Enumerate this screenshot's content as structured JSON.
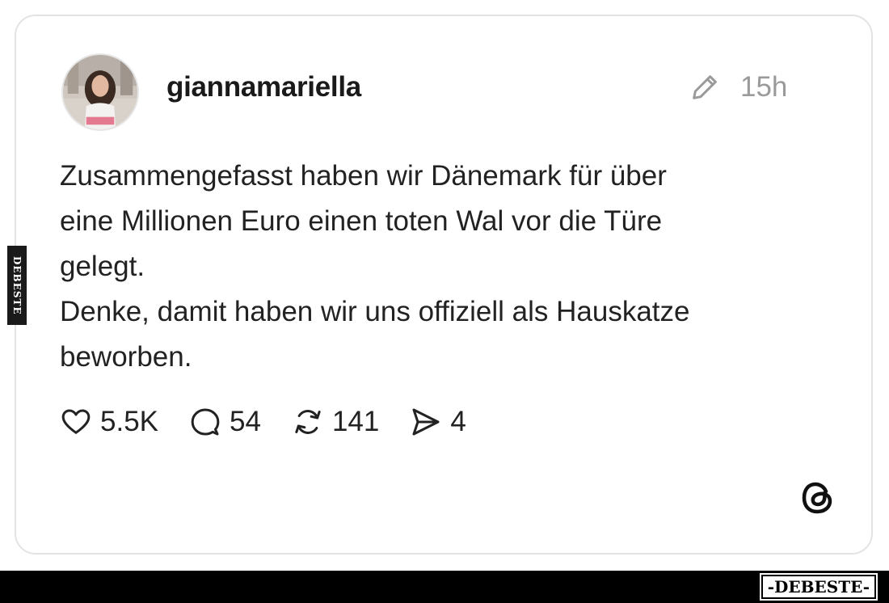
{
  "post": {
    "username": "giannamariella",
    "time": "15h",
    "text": "Zusammengefasst haben wir Dänemark für über\neine Millionen Euro einen toten Wal vor die Türe\ngelegt.\nDenke, damit haben wir uns offiziell als Hauskatze\nbeworben.",
    "likes": "5.5K",
    "replies": "54",
    "reposts": "141",
    "shares": "4"
  },
  "icons": {
    "edit": "pencil-icon",
    "like": "heart-icon",
    "reply": "speech-bubble-icon",
    "repost": "repost-icon",
    "share": "paper-plane-icon",
    "brand": "threads-logo-icon"
  },
  "watermark": {
    "side": "DEBESTE",
    "footer": "-DEBESTE-"
  },
  "colors": {
    "card_border": "#e3e3e3",
    "time_text": "#9a9a9a",
    "footer_bar": "#000000"
  }
}
